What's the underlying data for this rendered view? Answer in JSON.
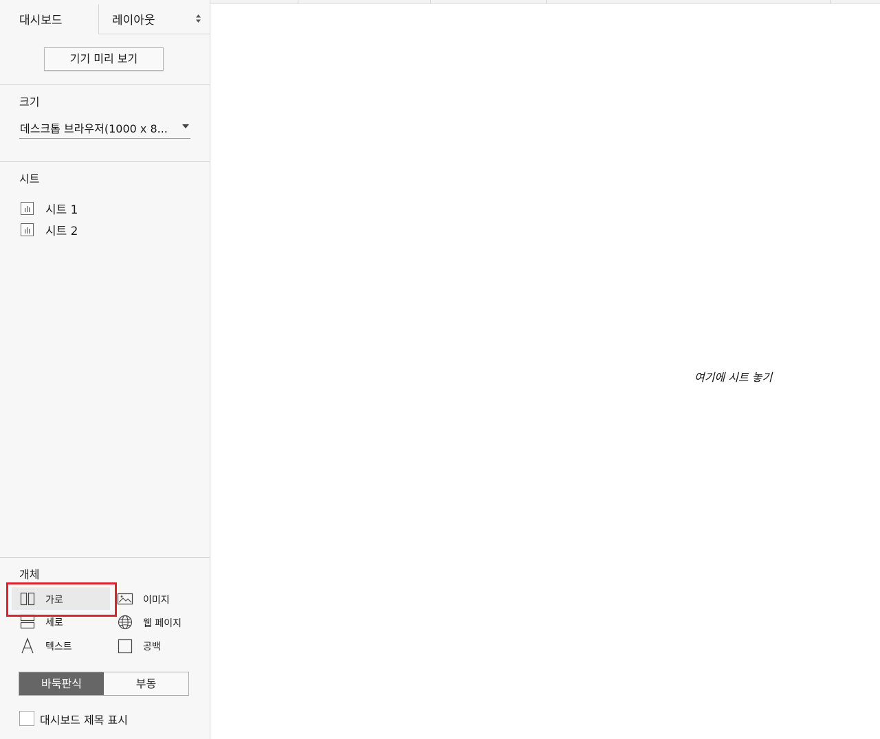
{
  "tabs": {
    "dashboard_label": "대시보드",
    "layout_label": "레이아웃"
  },
  "device_preview_label": "기기 미리 보기",
  "size": {
    "title": "크기",
    "selected_value": "데스크톱 브라우저(1000 x 8..."
  },
  "sheets": {
    "title": "시트",
    "items": [
      {
        "label": "시트 1",
        "icon": "bar-chart-icon"
      },
      {
        "label": "시트 2",
        "icon": "bar-chart-icon"
      }
    ]
  },
  "objects": {
    "title": "개체",
    "items": [
      {
        "label": "가로",
        "icon": "horizontal-container-icon"
      },
      {
        "label": "이미지",
        "icon": "image-icon"
      },
      {
        "label": "세로",
        "icon": "vertical-container-icon"
      },
      {
        "label": "웹 페이지",
        "icon": "globe-icon"
      },
      {
        "label": "텍스트",
        "icon": "text-icon"
      },
      {
        "label": "공백",
        "icon": "blank-icon"
      }
    ]
  },
  "layout_mode": {
    "tiled_label": "바둑판식",
    "floating_label": "부동",
    "selected": "tiled"
  },
  "show_title": {
    "label": "대시보드 제목 표시",
    "checked": false
  },
  "canvas": {
    "drop_hint": "여기에 시트 놓기"
  },
  "colors": {
    "highlight": "#d9232d",
    "toggle_active": "#666666"
  }
}
